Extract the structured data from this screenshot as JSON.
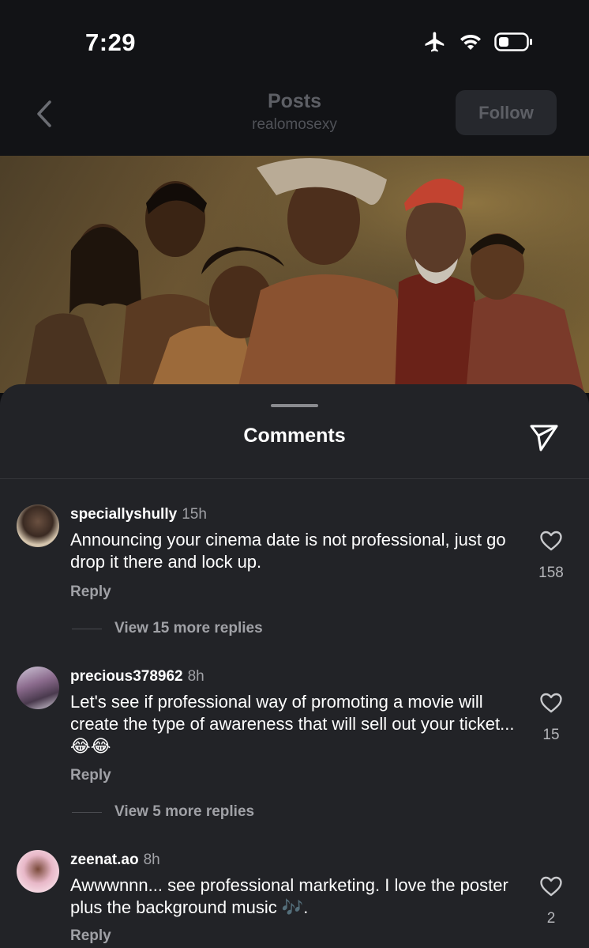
{
  "status_bar": {
    "time": "7:29",
    "icons": [
      "airplane-icon",
      "wifi-icon",
      "battery-icon"
    ]
  },
  "header": {
    "title": "Posts",
    "subtitle": "realomosexy",
    "follow_label": "Follow",
    "back_icon": "chevron-left-icon"
  },
  "sheet": {
    "title": "Comments",
    "share_icon": "send-icon"
  },
  "comments": [
    {
      "username": "speciallyshully",
      "time": "15h",
      "text": "Announcing your cinema date is not professional, just go drop it there and lock up.",
      "reply_label": "Reply",
      "likes": "158",
      "view_replies": "View 15 more replies"
    },
    {
      "username": "precious378962",
      "time": "8h",
      "text": "Let's see if professional way of promoting a movie will create the type of awareness that will sell out your ticket...😂😂",
      "reply_label": "Reply",
      "likes": "15",
      "view_replies": "View 5 more replies"
    },
    {
      "username": "zeenat.ao",
      "time": "8h",
      "text": "Awwwnnn... see professional marketing. I love the poster plus the background music 🎶.",
      "reply_label": "Reply",
      "likes": "2"
    }
  ],
  "colors": {
    "background": "#0c0d10",
    "sheet": "#222327",
    "muted_text": "#a0a1a6"
  }
}
